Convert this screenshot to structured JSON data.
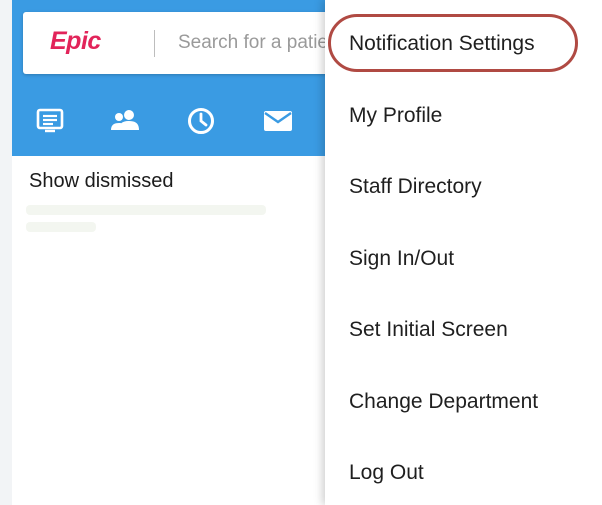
{
  "header": {
    "logo_text": "Epic",
    "search_placeholder": "Search for a patient"
  },
  "toolbar": {
    "icons": [
      "schedule-list-icon",
      "patients-icon",
      "clock-icon",
      "mail-icon"
    ]
  },
  "main": {
    "show_dismissed_label": "Show dismissed"
  },
  "menu": {
    "items": [
      {
        "label": "Notification Settings",
        "highlighted": true
      },
      {
        "label": "My Profile"
      },
      {
        "label": "Staff Directory"
      },
      {
        "label": "Sign In/Out"
      },
      {
        "label": "Set Initial Screen"
      },
      {
        "label": "Change Department"
      },
      {
        "label": "Log Out"
      }
    ]
  },
  "colors": {
    "header_blue": "#3a9be3",
    "epic_pink": "#e2245a",
    "annotation_ring": "#b04a43"
  }
}
